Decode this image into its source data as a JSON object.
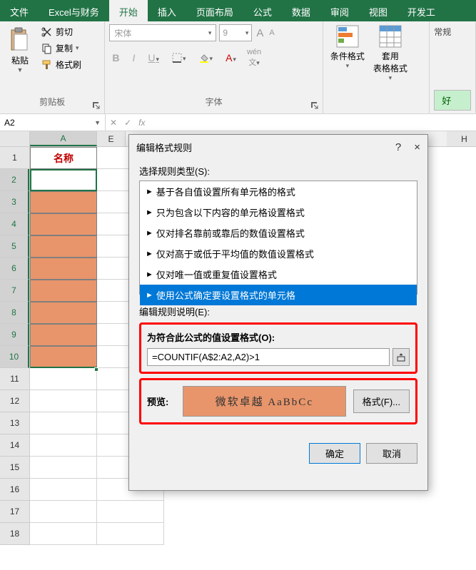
{
  "ribbon": {
    "tabs": {
      "file": "文件",
      "excel_finance": "Excel与财务",
      "home": "开始",
      "insert": "插入",
      "page_layout": "页面布局",
      "formulas": "公式",
      "data": "数据",
      "review": "审阅",
      "view": "视图",
      "developer": "开发工"
    },
    "clipboard": {
      "paste": "粘贴",
      "cut": "剪切",
      "copy": "复制",
      "format_painter": "格式刷",
      "group_label": "剪贴板"
    },
    "font": {
      "name": "宋体",
      "size": "9",
      "group_label": "字体",
      "wen": "wén",
      "wen_char": "文"
    },
    "styles": {
      "conditional_formatting": "条件格式",
      "format_as_table": "套用\n表格格式",
      "normal": "常规",
      "good": "好"
    }
  },
  "namebox": {
    "ref": "A2"
  },
  "sheet": {
    "col_A": "A",
    "col_E": "E",
    "col_H": "H",
    "header_cell": "名称",
    "rows": [
      "1",
      "2",
      "3",
      "4",
      "5",
      "6",
      "7",
      "8",
      "9",
      "10",
      "11",
      "12",
      "13",
      "14",
      "15",
      "16",
      "17",
      "18"
    ]
  },
  "dialog": {
    "title": "编辑格式规则",
    "help": "?",
    "close": "×",
    "select_rule_type": "选择规则类型(S):",
    "rules": {
      "r1": "基于各自值设置所有单元格的格式",
      "r2": "只为包含以下内容的单元格设置格式",
      "r3": "仅对排名靠前或靠后的数值设置格式",
      "r4": "仅对高于或低于平均值的数值设置格式",
      "r5": "仅对唯一值或重复值设置格式",
      "r6": "使用公式确定要设置格式的单元格"
    },
    "edit_desc": "编辑规则说明(E):",
    "formula_label": "为符合此公式的值设置格式(O):",
    "formula_value": "=COUNTIF(A$2:A2,A2)>1",
    "preview_label": "预览:",
    "preview_text": "微软卓越  AaBbCc",
    "format_btn": "格式(F)...",
    "ok": "确定",
    "cancel": "取消"
  }
}
